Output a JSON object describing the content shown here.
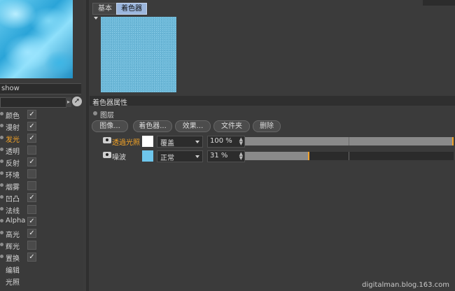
{
  "left": {
    "material_name": "show",
    "channels": [
      {
        "label": "颜色",
        "checked": true,
        "active": false,
        "has_dot": true
      },
      {
        "label": "漫射",
        "checked": true,
        "active": false,
        "has_dot": true
      },
      {
        "label": "发光",
        "checked": true,
        "active": true,
        "has_dot": true
      },
      {
        "label": "透明",
        "checked": false,
        "active": false,
        "has_dot": true
      },
      {
        "label": "反射",
        "checked": true,
        "active": false,
        "has_dot": true
      },
      {
        "label": "环境",
        "checked": false,
        "active": false,
        "has_dot": true
      },
      {
        "label": "烟雾",
        "checked": false,
        "active": false,
        "has_dot": true
      },
      {
        "label": "凹凸",
        "checked": true,
        "active": false,
        "has_dot": true
      },
      {
        "label": "法线",
        "checked": false,
        "active": false,
        "has_dot": true
      },
      {
        "label": "Alpha",
        "checked": true,
        "active": false,
        "has_dot": true
      },
      {
        "label": "高光",
        "checked": true,
        "active": false,
        "has_dot": true
      },
      {
        "label": "辉光",
        "checked": false,
        "active": false,
        "has_dot": true
      },
      {
        "label": "置换",
        "checked": true,
        "active": false,
        "has_dot": true
      },
      {
        "label": "编辑",
        "checked": null,
        "active": false,
        "has_dot": false
      },
      {
        "label": "光照",
        "checked": null,
        "active": false,
        "has_dot": false
      }
    ]
  },
  "tabs": {
    "basic": "基本",
    "shader": "着色器"
  },
  "section": {
    "title": "着色器属性"
  },
  "layer_option": "图层",
  "buttons": {
    "image": "图像...",
    "shader": "着色器...",
    "effect": "效果...",
    "folder": "文件夹",
    "delete": "删除"
  },
  "layers": [
    {
      "name": "透過光照",
      "name_color": "#f3a327",
      "swatch": "#ffffff",
      "blend_mode": "覆盖",
      "percent_label": "100 %",
      "value": 1.0
    },
    {
      "name": "噪波",
      "name_color": "#d4d4d4",
      "swatch": "#6ec6ec",
      "blend_mode": "正常",
      "percent_label": "31 %",
      "value": 0.31
    }
  ],
  "watermark": "digitalman.blog.163.com",
  "colors": {
    "accent": "#f3a327",
    "active_tab": "#9bb6dd"
  }
}
